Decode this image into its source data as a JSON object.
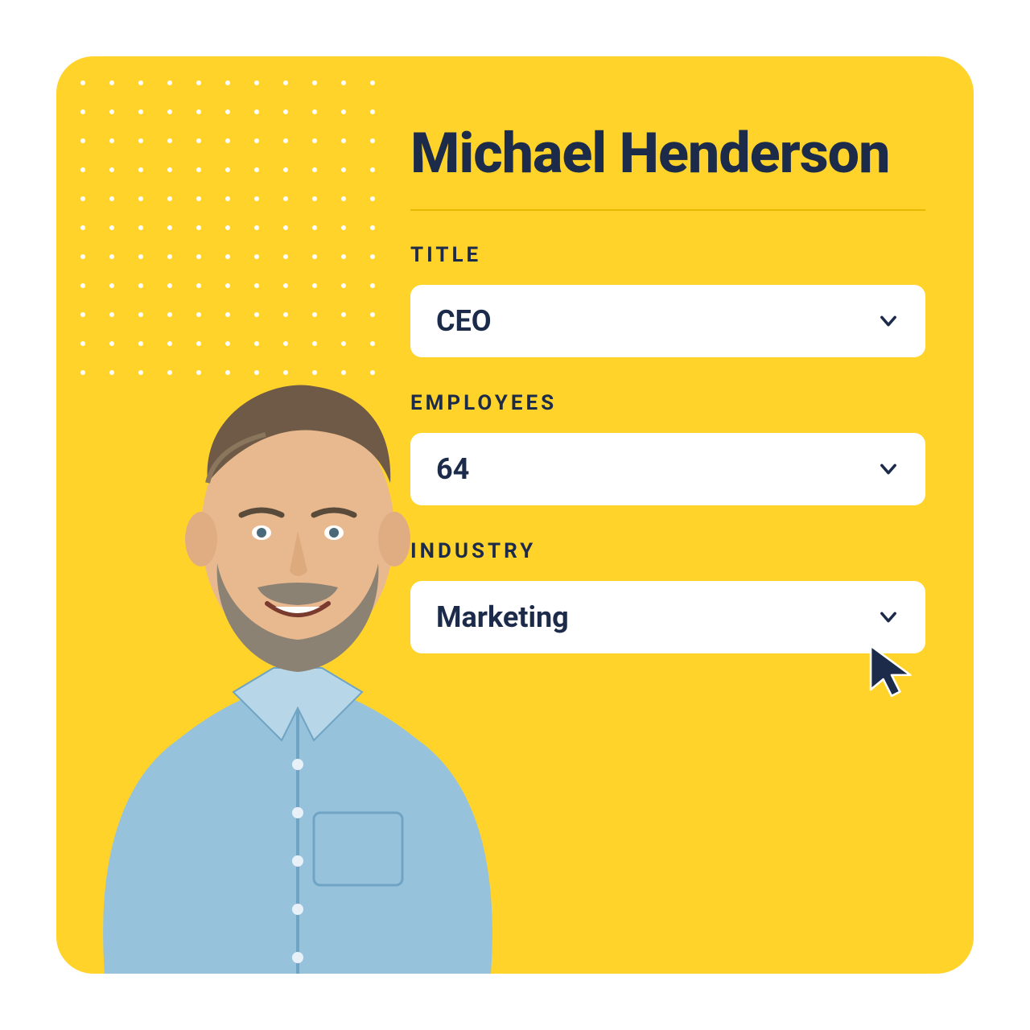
{
  "colors": {
    "bg": "#FFD32A",
    "ink": "#1C2B4A",
    "rule": "#E6B800"
  },
  "profile": {
    "name": "Michael Henderson"
  },
  "fields": {
    "title": {
      "label": "TITLE",
      "value": "CEO"
    },
    "employees": {
      "label": "EMPLOYEES",
      "value": "64"
    },
    "industry": {
      "label": "INDUSTRY",
      "value": "Marketing"
    }
  }
}
